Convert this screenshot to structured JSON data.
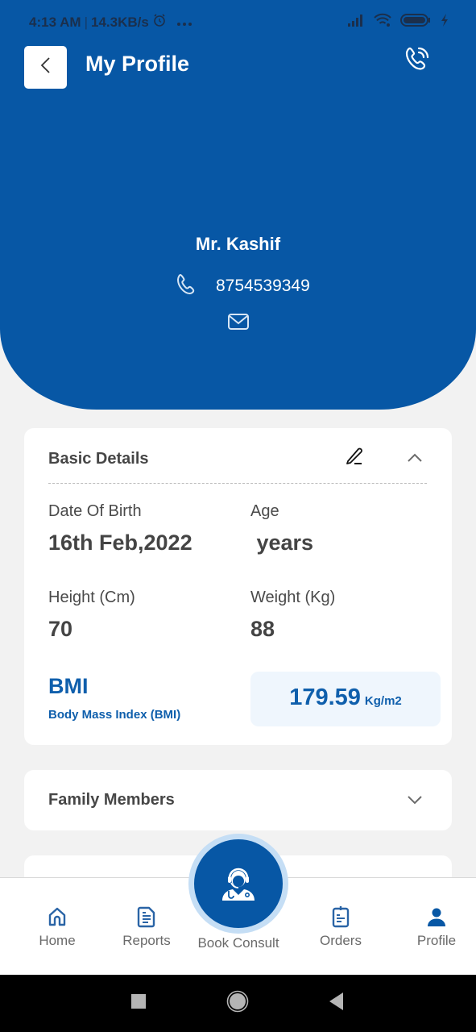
{
  "status_bar": {
    "time": "4:13 AM",
    "separator": "|",
    "network_speed": "14.3KB/s",
    "battery": "100",
    "icons": [
      "alarm-icon",
      "more-dots-icon",
      "signal-icon",
      "wifi-icon",
      "battery-icon",
      "charging-icon"
    ]
  },
  "header": {
    "title": "My Profile",
    "back_icon": "chevron-left-icon",
    "call_icon": "phone-call-icon"
  },
  "profile": {
    "name": "Mr. Kashif",
    "phone": "8754539349",
    "phone_icon": "phone-icon",
    "email_icon": "mail-icon"
  },
  "basic_details": {
    "title": "Basic Details",
    "edit_icon": "pencil-icon",
    "collapse_icon": "chevron-up-icon",
    "fields": [
      {
        "label": "Date Of Birth",
        "value": "16th Feb,2022"
      },
      {
        "label": "Age",
        "value": " years"
      },
      {
        "label": "Height (Cm)",
        "value": "70"
      },
      {
        "label": "Weight (Kg)",
        "value": "88"
      }
    ],
    "bmi": {
      "title": "BMI",
      "subtitle": "Body Mass Index (BMI)",
      "value": "179.59",
      "unit": "Kg/m2"
    }
  },
  "family_members": {
    "title": "Family Members",
    "expand_icon": "chevron-down-icon"
  },
  "bottom_nav": {
    "items": [
      {
        "label": "Home",
        "icon": "home-icon"
      },
      {
        "label": "Reports",
        "icon": "document-icon"
      },
      {
        "label": "Book Consult",
        "icon": "doctor-headset-icon"
      },
      {
        "label": "Orders",
        "icon": "clipboard-icon"
      },
      {
        "label": "Profile",
        "icon": "user-icon",
        "active": true
      }
    ]
  },
  "colors": {
    "primary": "#0757a5",
    "background": "#f2f2f2",
    "text_dark": "#444444",
    "bmi_accent": "#0f5fac",
    "nav_icon": "#2a64a6"
  }
}
